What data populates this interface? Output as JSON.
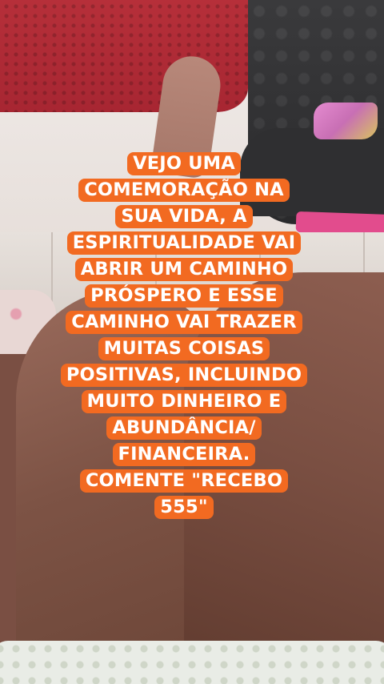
{
  "caption": {
    "lines": [
      "VEJO UMA",
      "COMEMORAÇÃO NA",
      "SUA VIDA, A",
      "ESPIRITUALIDADE VAI",
      "ABRIR UM CAMINHO",
      "PRÓSPERO E ESSE",
      "CAMINHO VAI TRAZER",
      "MUITAS COISAS",
      "POSITIVAS, INCLUINDO",
      "MUITO DINHEIRO E",
      "ABUNDÂNCIA/",
      "FINANCEIRA.",
      "COMENTE \"RECEBO",
      "555\""
    ],
    "background_color": "#f26a21",
    "text_color": "#ffffff"
  }
}
